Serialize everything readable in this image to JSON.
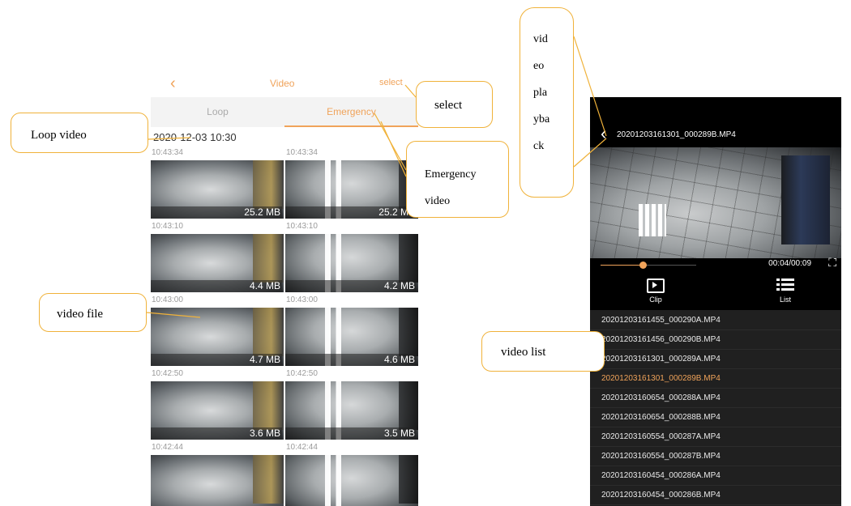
{
  "gallery": {
    "back_icon": "chevron-left-icon",
    "title": "Video",
    "select_label": "select",
    "tabs": [
      {
        "label": "Loop"
      },
      {
        "label": "Emergency"
      }
    ],
    "active_tab": "Emergency",
    "date": "2020-12-03 10:30",
    "rows": [
      {
        "left_time": "10:43:34",
        "right_time": "10:43:34",
        "left_size": "25.2 MB",
        "right_size": "25.2 MB"
      },
      {
        "left_time": "10:43:10",
        "right_time": "10:43:10",
        "left_size": "4.4 MB",
        "right_size": "4.2 MB"
      },
      {
        "left_time": "10:43:00",
        "right_time": "10:43:00",
        "left_size": "4.7 MB",
        "right_size": "4.6 MB"
      },
      {
        "left_time": "10:42:50",
        "right_time": "10:42:50",
        "left_size": "3.6 MB",
        "right_size": "3.5 MB"
      },
      {
        "left_time": "10:42:44",
        "right_time": "10:42:44",
        "left_size": "",
        "right_size": ""
      }
    ]
  },
  "player": {
    "back_icon": "chevron-left-icon",
    "filename": "20201203161301_000289B.MP4",
    "progress_fraction": 0.44,
    "time": "00:04/00:09",
    "fullscreen_icon": "fullscreen-icon",
    "actions": [
      {
        "label": "Clip",
        "icon": "clip-icon"
      },
      {
        "label": "List",
        "icon": "list-icon"
      }
    ],
    "list": [
      "20201203161455_000290A.MP4",
      "20201203161456_000290B.MP4",
      "20201203161301_000289A.MP4",
      "20201203161301_000289B.MP4",
      "20201203160654_000288A.MP4",
      "20201203160654_000288B.MP4",
      "20201203160554_000287A.MP4",
      "20201203160554_000287B.MP4",
      "20201203160454_000286A.MP4",
      "20201203160454_000286B.MP4"
    ],
    "active_index": 3
  },
  "callouts": {
    "loop": "Loop video",
    "select": "select",
    "emergency": [
      "Emergency",
      "video"
    ],
    "file": "video file",
    "list": "video list",
    "playback": [
      "vid",
      "eo",
      "pla",
      "yba",
      "ck"
    ]
  },
  "colors": {
    "accent": "#f0a35a",
    "callout_border": "#f0b23a",
    "player_bg": "#202020"
  }
}
